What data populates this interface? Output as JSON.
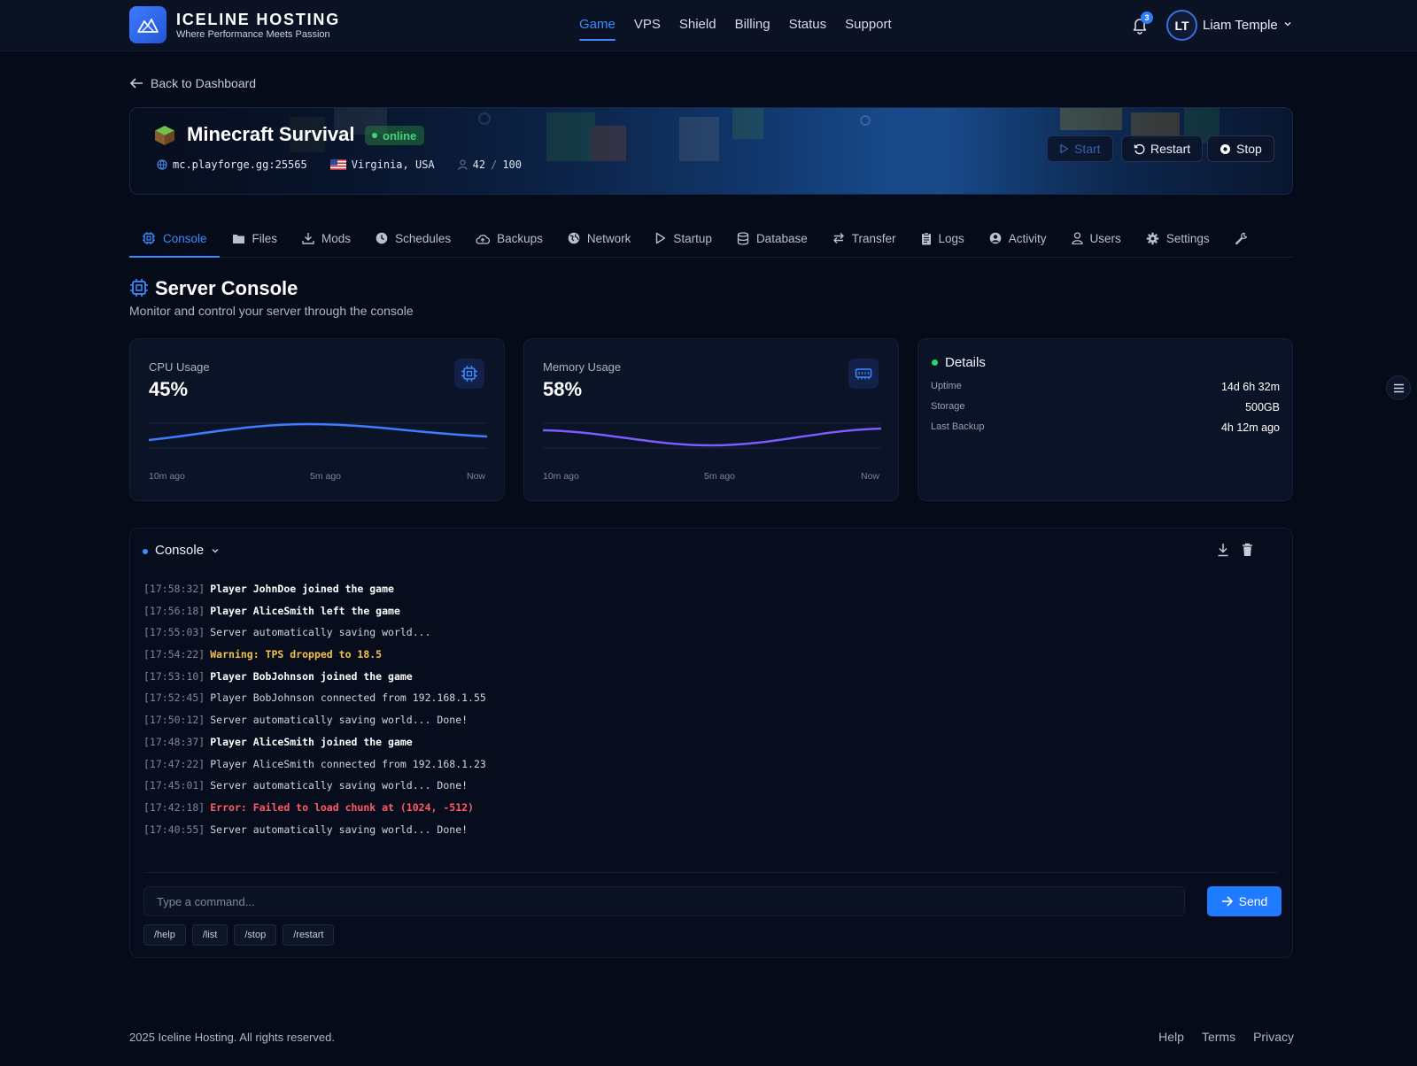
{
  "brand": {
    "name": "ICELINE HOSTING",
    "tagline": "Where Performance Meets Passion"
  },
  "nav": {
    "items": [
      "Game",
      "VPS",
      "Shield",
      "Billing",
      "Status",
      "Support"
    ],
    "active": "Game"
  },
  "user": {
    "notifications": "3",
    "initials": "LT",
    "name": "Liam Temple"
  },
  "back_link": "Back to Dashboard",
  "server": {
    "name": "Minecraft Survival",
    "status": "online",
    "address": "mc.playforge.gg:25565",
    "location": "Virginia, USA",
    "players_online": "42",
    "players_sep": "/",
    "players_max": "100",
    "buttons": {
      "start": "Start",
      "restart": "Restart",
      "stop": "Stop"
    }
  },
  "tabs": [
    "Console",
    "Files",
    "Mods",
    "Schedules",
    "Backups",
    "Network",
    "Startup",
    "Database",
    "Transfer",
    "Logs",
    "Activity",
    "Users",
    "Settings"
  ],
  "tab_icons": [
    "cpu-icon",
    "folder-icon",
    "download-icon",
    "clock-icon",
    "cloud-upload-icon",
    "globe-icon",
    "play-icon",
    "database-icon",
    "transfer-icon",
    "clipboard-icon",
    "user-circle-icon",
    "user-icon",
    "gear-icon"
  ],
  "section": {
    "title": "Server Console",
    "subtitle": "Monitor and control your server through the console"
  },
  "cpu": {
    "label": "CPU Usage",
    "value": "45%",
    "axis": [
      "10m ago",
      "5m ago",
      "Now"
    ],
    "color": "#3d7dff"
  },
  "memory": {
    "label": "Memory Usage",
    "value": "58%",
    "axis": [
      "10m ago",
      "5m ago",
      "Now"
    ],
    "color": "#7a5cff"
  },
  "details": {
    "title": "Details",
    "rows": [
      {
        "k": "Uptime",
        "v": "14d 6h 32m"
      },
      {
        "k": "Storage",
        "v": "500GB"
      },
      {
        "k": "Last Backup",
        "v": "4h 12m ago"
      }
    ]
  },
  "console": {
    "title": "Console",
    "lines": [
      {
        "ts": "[17:58:32]",
        "msg": "Player JohnDoe joined the game",
        "kind": "join"
      },
      {
        "ts": "[17:56:18]",
        "msg": "Player AliceSmith left the game",
        "kind": "join"
      },
      {
        "ts": "[17:55:03]",
        "msg": "Server automatically saving world...",
        "kind": "info"
      },
      {
        "ts": "[17:54:22]",
        "msg": "Warning: TPS dropped to 18.5",
        "kind": "warning"
      },
      {
        "ts": "[17:53:10]",
        "msg": "Player BobJohnson joined the game",
        "kind": "join"
      },
      {
        "ts": "[17:52:45]",
        "msg": "Player BobJohnson connected from 192.168.1.55",
        "kind": "info"
      },
      {
        "ts": "[17:50:12]",
        "msg": "Server automatically saving world... Done!",
        "kind": "info"
      },
      {
        "ts": "[17:48:37]",
        "msg": "Player AliceSmith joined the game",
        "kind": "join"
      },
      {
        "ts": "[17:47:22]",
        "msg": "Player AliceSmith connected from 192.168.1.23",
        "kind": "info"
      },
      {
        "ts": "[17:45:01]",
        "msg": "Server automatically saving world... Done!",
        "kind": "info"
      },
      {
        "ts": "[17:42:18]",
        "msg": "Error: Failed to load chunk at (1024, -512)",
        "kind": "error"
      },
      {
        "ts": "[17:40:55]",
        "msg": "Server automatically saving world... Done!",
        "kind": "info"
      }
    ],
    "input_placeholder": "Type a command...",
    "send": "Send",
    "quick": [
      "/help",
      "/list",
      "/stop",
      "/restart"
    ]
  },
  "footer": {
    "copyright": "2025 Iceline Hosting. All rights reserved.",
    "links": [
      "Help",
      "Terms",
      "Privacy"
    ]
  }
}
